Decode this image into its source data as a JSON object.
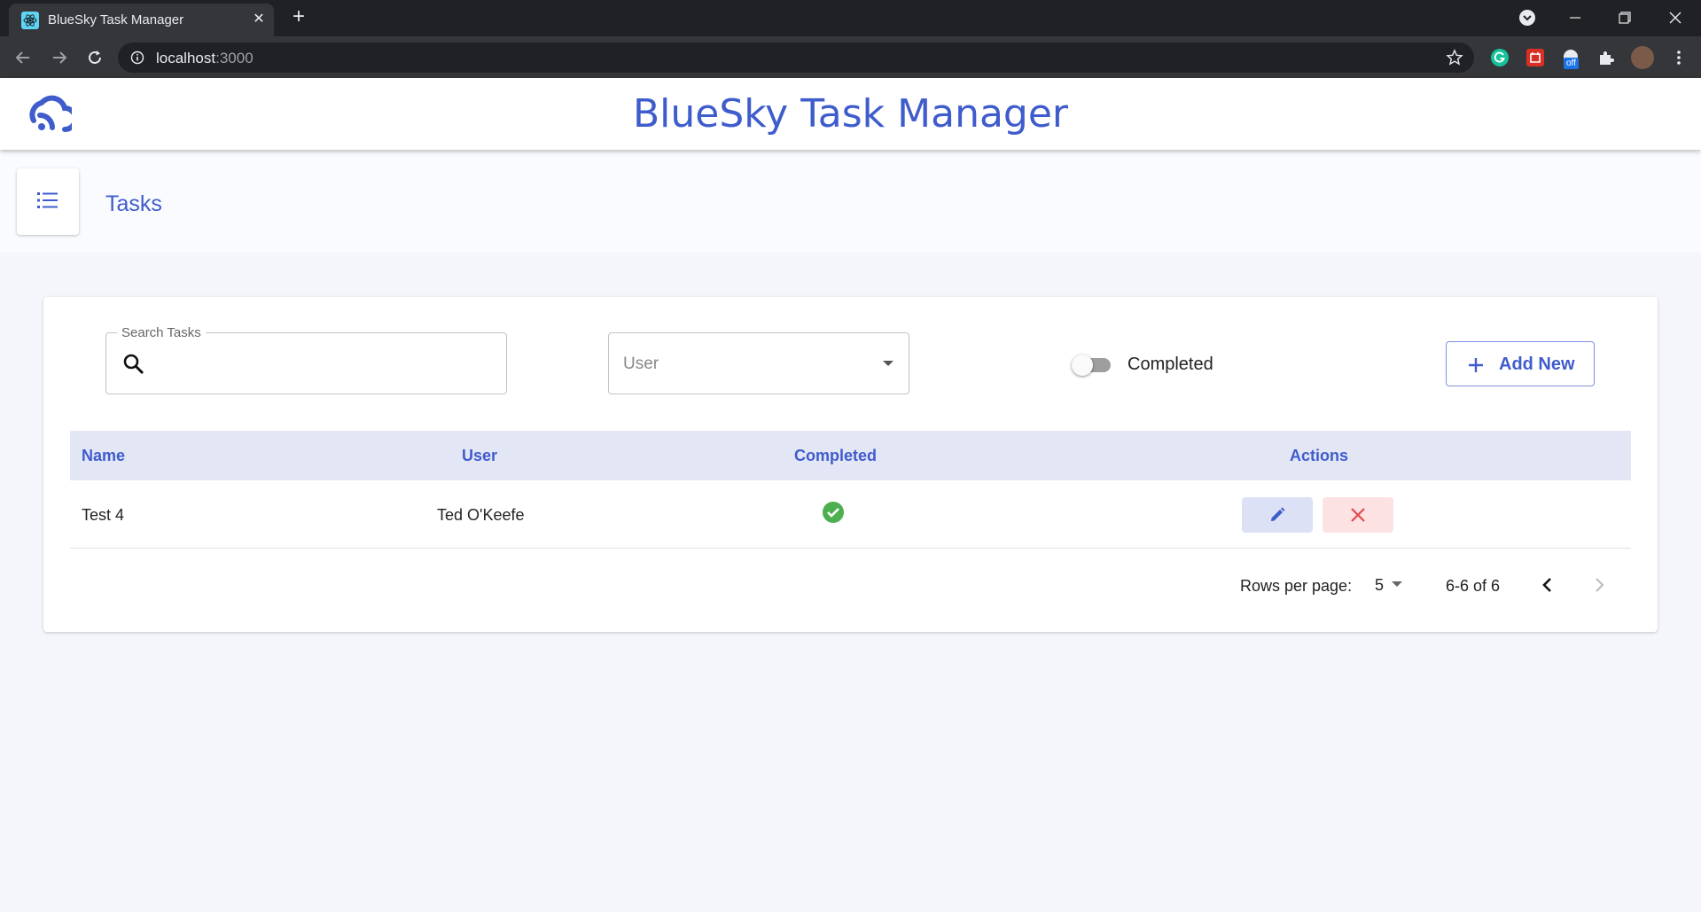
{
  "browser": {
    "tab_title": "BlueSky Task Manager",
    "url_host": "localhost",
    "url_port": ":3000",
    "extension_badge": "off"
  },
  "app": {
    "title": "BlueSky Task Manager",
    "accent_color": "#3f5ccc"
  },
  "page": {
    "title": "Tasks"
  },
  "filters": {
    "search_label": "Search Tasks",
    "search_value": "",
    "user_placeholder": "User",
    "completed_toggle_label": "Completed",
    "completed_toggle_on": false,
    "add_button_label": "Add New"
  },
  "table": {
    "columns": [
      "Name",
      "User",
      "Completed",
      "Actions"
    ],
    "rows": [
      {
        "name": "Test 4",
        "user": "Ted O'Keefe",
        "completed": true
      }
    ]
  },
  "pagination": {
    "rows_per_page_label": "Rows per page:",
    "rows_per_page": "5",
    "range": "6-6 of 6"
  },
  "icons": {
    "logo": "cloud-rss-icon",
    "page": "list-icon",
    "search": "search-icon",
    "add": "plus-icon",
    "completed": "check-circle-icon",
    "edit": "pencil-icon",
    "delete": "close-icon"
  }
}
